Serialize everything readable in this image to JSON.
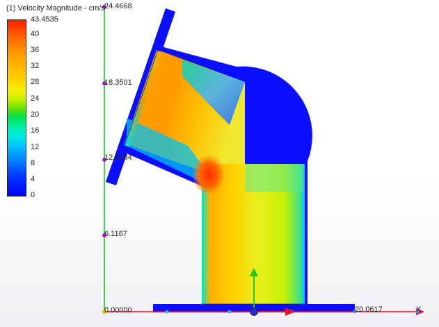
{
  "legend": {
    "title": "(1) Velocity Magnitude - cm/s",
    "ticks": [
      "43.4535",
      "40",
      "36",
      "32",
      "28",
      "24",
      "20",
      "16",
      "12",
      "8",
      "4",
      "0"
    ]
  },
  "y_axis": {
    "labels": [
      "24.4668",
      "18.3501",
      "12.2334",
      "6.1167"
    ],
    "origin_label": "0.00000"
  },
  "x_axis": {
    "end_label": "20.0617",
    "name": "X"
  },
  "colors": {
    "y_axis": "#22c22a",
    "x_axis": "#e01530",
    "marker": "#a020c0",
    "triad_z": "#2a2ac8",
    "solid_fill": "#0a10ff",
    "flow_hot": "#ff4a00",
    "flow_mid": "#f0e020",
    "flow_cool": "#00e8d0"
  },
  "icons": [
    "axis-triad-icon"
  ]
}
